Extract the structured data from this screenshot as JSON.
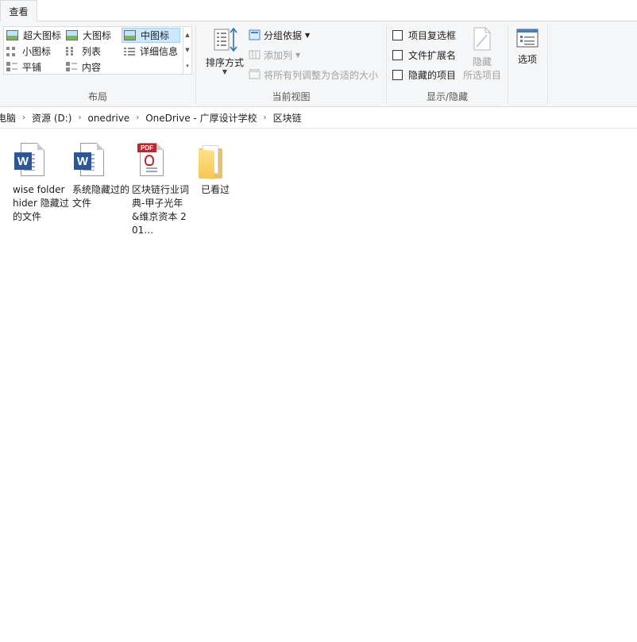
{
  "tabs": {
    "active": "查看"
  },
  "ribbon": {
    "layout": {
      "group_label": "布局",
      "items": [
        {
          "label": "超大图标"
        },
        {
          "label": "大图标"
        },
        {
          "label": "中图标",
          "selected": true
        },
        {
          "label": "小图标"
        },
        {
          "label": "列表"
        },
        {
          "label": "详细信息"
        },
        {
          "label": "平铺"
        },
        {
          "label": "内容"
        }
      ]
    },
    "current_view": {
      "group_label": "当前视图",
      "sort_label": "排序方式",
      "group_by_label": "分组依据",
      "add_columns_label": "添加列",
      "fit_columns_label": "将所有列调整为合适的大小"
    },
    "show_hide": {
      "group_label": "显示/隐藏",
      "item_checkboxes": "项目复选框",
      "file_extensions": "文件扩展名",
      "hidden_items": "隐藏的项目",
      "hide_selected_line1": "隐藏",
      "hide_selected_line2": "所选项目"
    },
    "options": {
      "label": "选项"
    }
  },
  "address": {
    "crumbs": [
      "电脑",
      "资源 (D:)",
      "onedrive",
      "OneDrive - 广厚设计学校",
      "区块链"
    ]
  },
  "files": [
    {
      "name": "wise folder hider 隐藏过的文件",
      "type": "word"
    },
    {
      "name": "系统隐藏过的文件",
      "type": "word"
    },
    {
      "name": "区块链行业词典-甲子光年&维京资本 201…",
      "type": "pdf"
    },
    {
      "name": "已看过",
      "type": "folder"
    }
  ],
  "colors": {
    "word_blue": "#2b5797",
    "pdf_red": "#c0272d",
    "selection_bg": "#cce8ff",
    "ribbon_bg": "#f5f6f7"
  }
}
